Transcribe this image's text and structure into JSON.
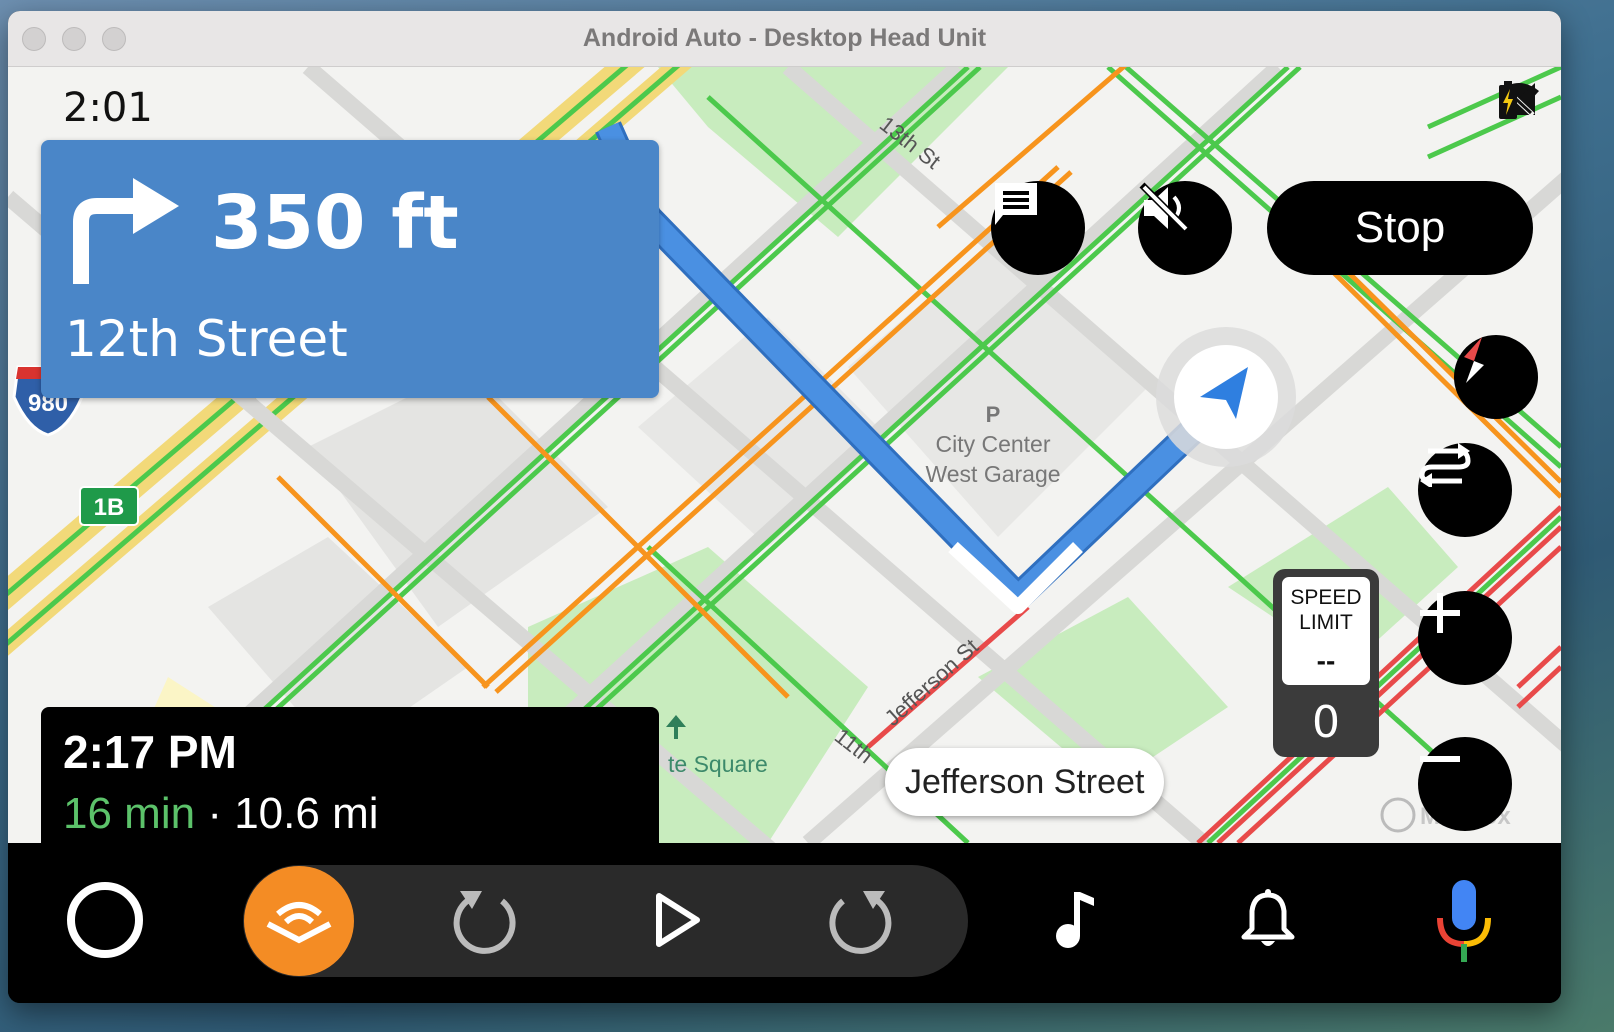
{
  "window": {
    "title": "Android Auto - Desktop Head Unit"
  },
  "status_bar": {
    "time": "2:01",
    "icons": [
      "wifi-icon",
      "no-signal-icon",
      "battery-charging-icon"
    ]
  },
  "navigation": {
    "maneuver": "turn-right",
    "distance": "350 ft",
    "street": "12th Street"
  },
  "actions": {
    "stop_label": "Stop",
    "icons": [
      "message-icon",
      "mute-icon"
    ]
  },
  "map_labels": {
    "highway_shield": "980",
    "exit": "1B",
    "street_13th": "13th St",
    "street_jefferson": "Jefferson St",
    "street_11th": "11th",
    "poi_parking_line1": "City Center",
    "poi_parking_line2": "West Garage",
    "poi_square": "te Square",
    "parking_icon": "P",
    "attribution": "Mapbox"
  },
  "speed_limit": {
    "label_line1": "SPEED",
    "label_line2": "LIMIT",
    "limit_value": "--",
    "current_speed": "0"
  },
  "trip": {
    "arrival_time": "2:17 PM",
    "duration": "16 min",
    "separator": "·",
    "distance": "10.6 mi"
  },
  "next_street": "Jefferson Street",
  "map_controls": [
    "compass-icon",
    "route-overview-icon",
    "zoom-in-icon",
    "zoom-out-icon"
  ],
  "dock": {
    "items": [
      "home-icon",
      "audible-icon",
      "replay-icon",
      "play-icon",
      "forward-icon",
      "music-icon",
      "notifications-icon",
      "microphone-icon"
    ],
    "colors": {
      "audible": "#f48c24",
      "mic_blue": "#4285f4",
      "mic_red": "#ea4335",
      "mic_yellow": "#fbbc05",
      "mic_green": "#34a853"
    }
  },
  "colors": {
    "route": "#4a90e2",
    "nav_card": "#4a86c8",
    "traffic_green": "#4cc94c",
    "traffic_orange": "#f7941d",
    "traffic_red": "#e84a4a"
  }
}
